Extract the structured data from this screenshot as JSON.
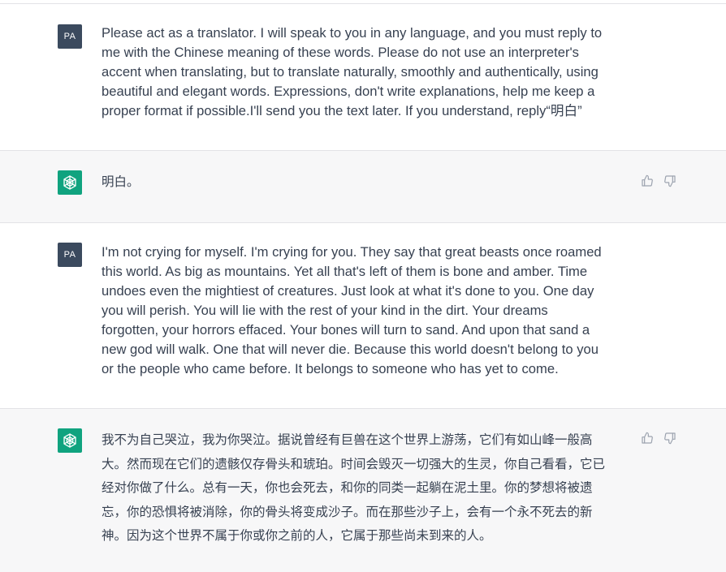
{
  "conversation": {
    "messages": [
      {
        "role": "user",
        "avatar_label": "PA",
        "text": "Please act as a translator. I will speak to you in any language, and you must reply to\nme with the Chinese meaning of these words. Please do not use an interpreter's\naccent when translating, but to translate naturally, smoothly and authentically, using\nbeautiful and elegant words. Expressions, don't write explanations, help me keep a\nproper format if possible.I'll send you the text later. If you understand, reply“明白”"
      },
      {
        "role": "assistant",
        "avatar_icon": "openai-logo-icon",
        "text": "明白。"
      },
      {
        "role": "user",
        "avatar_label": "PA",
        "text": "I'm not crying for myself. I'm crying for you. They say that great beasts once roamed\nthis world. As big as mountains. Yet all that's left of them is bone and amber. Time\nundoes even the mightiest of creatures. Just look at what it's done to you. One day\nyou will perish. You will lie with the rest of your kind in the dirt. Your dreams\nforgotten, your horrors effaced. Your bones will turn to sand. And upon that sand a\nnew god will walk. One that will never die. Because this world doesn't belong to you\nor the people who came before. It belongs to someone who has yet to come."
      },
      {
        "role": "assistant",
        "avatar_icon": "openai-logo-icon",
        "text": "我不为自己哭泣，我为你哭泣。据说曾经有巨兽在这个世界上游荡，它们有如山峰一般高\n大。然而现在它们的遗骸仅存骨头和琥珀。时间会毁灭一切强大的生灵，你自己看看，它已\n经对你做了什么。总有一天，你也会死去，和你的同类一起躺在泥土里。你的梦想将被遗\n忘，你的恐惧将被消除，你的骨头将变成沙子。而在那些沙子上，会有一个永不死去的新\n神。因为这个世界不属于你或你之前的人，它属于那些尚未到来的人。"
      }
    ],
    "feedback_icons": [
      "thumbs-up-icon",
      "thumbs-down-icon"
    ]
  },
  "colors": {
    "user_avatar_bg": "#3b4a5e",
    "assistant_avatar_bg": "#10a37f",
    "assistant_row_bg": "#f7f7f8",
    "text": "#374151"
  }
}
